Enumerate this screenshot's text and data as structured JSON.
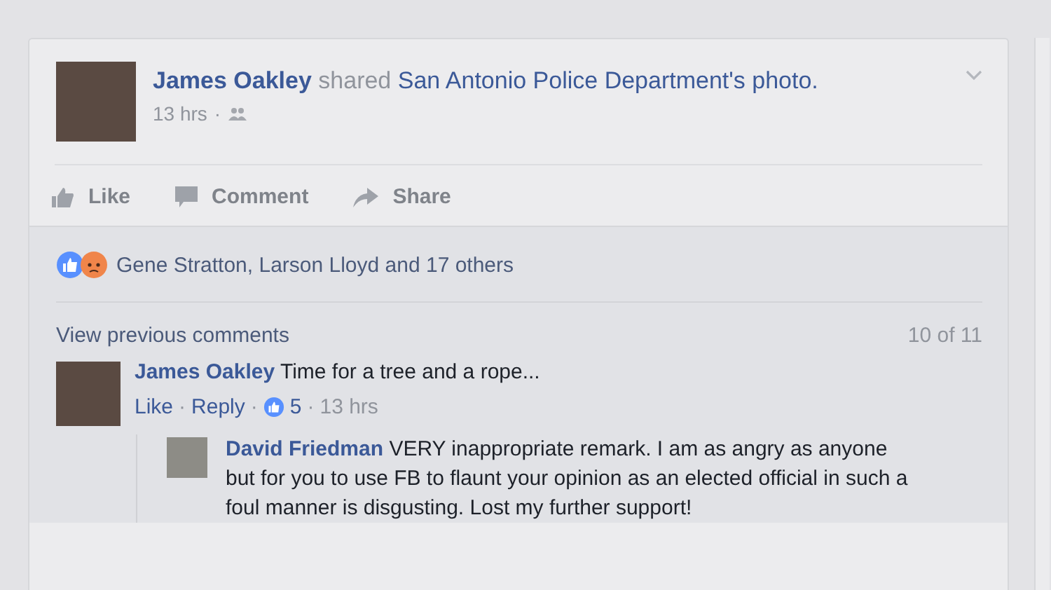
{
  "post": {
    "author": "James Oakley",
    "verb": "shared",
    "target": "San Antonio Police Department's",
    "target_object": "photo.",
    "time": "13 hrs",
    "separator": "·"
  },
  "actions": [
    "Like",
    "Comment",
    "Share"
  ],
  "reactions": {
    "text": "Gene Stratton, Larson Lloyd and 17 others"
  },
  "comments_header": {
    "link": "View previous comments",
    "count": "10 of 11"
  },
  "comments": [
    {
      "author": "James Oakley",
      "text": "Time for a tree and a rope...",
      "like": "Like",
      "separator": "·",
      "reply": "Reply",
      "likes": "5",
      "time": "13 hrs",
      "replies": [
        {
          "author": "David Friedman",
          "text": "VERY inappropriate remark. I am as angry as anyone but for you to use FB to flaunt your opinion as an elected official in such a foul manner is disgusting. Lost my further support!"
        }
      ]
    }
  ]
}
